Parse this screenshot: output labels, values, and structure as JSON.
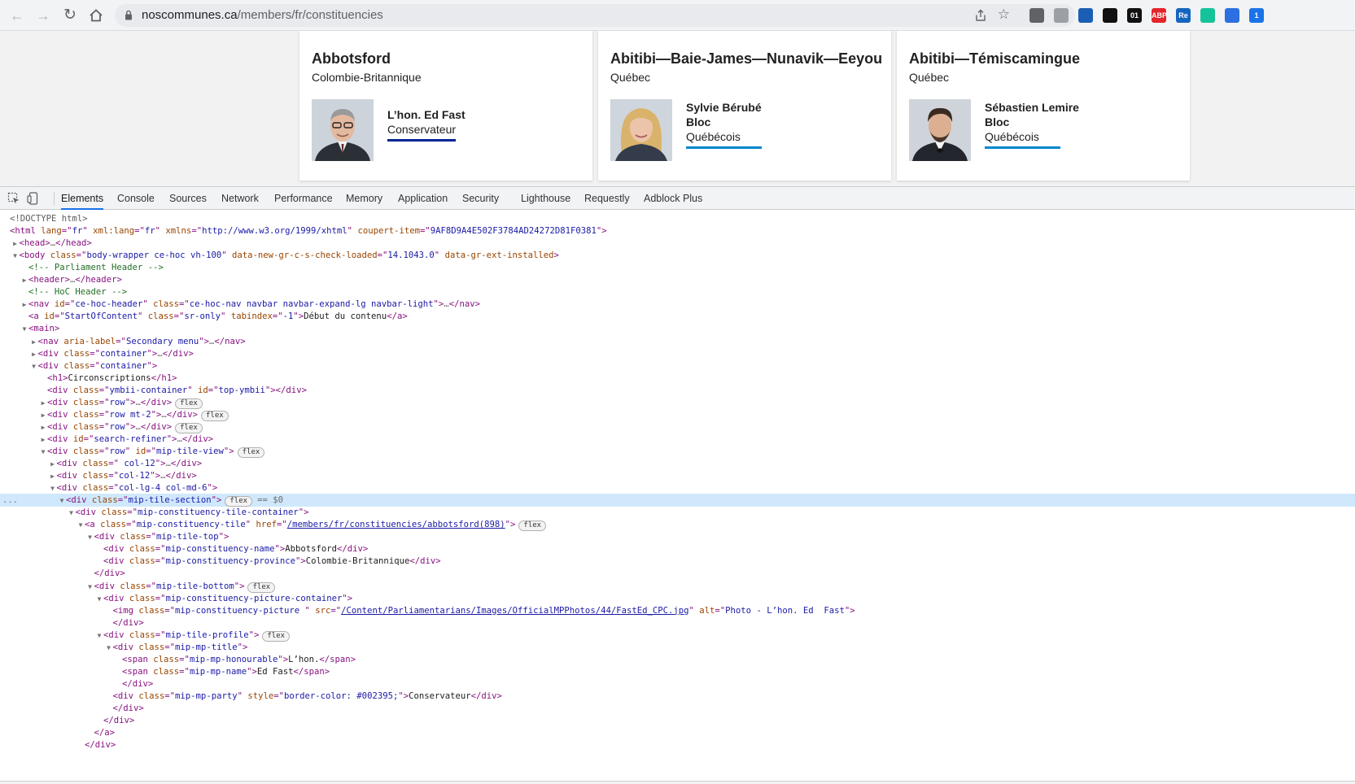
{
  "browser": {
    "url_host": "noscommunes.ca",
    "url_path": "/members/fr/constituencies",
    "extensions": [
      {
        "name": "search-ext",
        "label": "",
        "color": "#5f6368"
      },
      {
        "name": "reader-ext",
        "label": "",
        "color": "#9aa0a6"
      },
      {
        "name": "clock-ext",
        "label": "",
        "color": "#1a5fb4"
      },
      {
        "name": "notion-ext",
        "label": "",
        "color": "#111111"
      },
      {
        "name": "zero-one-ext",
        "label": "01",
        "color": "#111111"
      },
      {
        "name": "adblock-ext",
        "label": "ABP",
        "color": "#e3242b"
      },
      {
        "name": "re-ext",
        "label": "Re",
        "color": "#1565c0"
      },
      {
        "name": "grammarly-ext",
        "label": "",
        "color": "#15c39a"
      },
      {
        "name": "cap-ext",
        "label": "",
        "color": "#2c6fe0"
      },
      {
        "name": "person-ext",
        "label": "1",
        "color": "#1a73e8"
      }
    ]
  },
  "tiles": [
    {
      "name": "Abbotsford",
      "province": "Colombie-Britannique",
      "mp_lines": [
        "L’hon. Ed Fast"
      ],
      "party": "Conservateur",
      "party_color": "#002395"
    },
    {
      "name": "Abitibi—Baie-James—Nunavik—Eeyou",
      "province": "Québec",
      "mp_lines": [
        "Sylvie Bérubé",
        "Bloc"
      ],
      "party": "Québécois",
      "party_color": "#0088ce"
    },
    {
      "name": "Abitibi—Témiscamingue",
      "province": "Québec",
      "mp_lines": [
        "Sébastien Lemire",
        "Bloc"
      ],
      "party": "Québécois",
      "party_color": "#0088ce"
    }
  ],
  "devtools": {
    "tabs": [
      "Elements",
      "Console",
      "Sources",
      "Network",
      "Performance",
      "Memory",
      "Application",
      "Security",
      "Lighthouse",
      "Requestly",
      "Adblock Plus"
    ],
    "active_tab": "Elements"
  },
  "dom_lines": [
    [
      [
        0,
        "",
        ""
      ],
      [
        "dt",
        "<!DOCTYPE html>"
      ]
    ],
    [
      [
        0,
        "",
        ""
      ],
      [
        "tg",
        "<html "
      ],
      [
        "an",
        "lang"
      ],
      [
        "tg",
        "=\""
      ],
      [
        "av",
        "fr"
      ],
      [
        "tg",
        "\" "
      ],
      [
        "an",
        "xml:lang"
      ],
      [
        "tg",
        "=\""
      ],
      [
        "av",
        "fr"
      ],
      [
        "tg",
        "\" "
      ],
      [
        "an",
        "xmlns"
      ],
      [
        "tg",
        "=\""
      ],
      [
        "av",
        "http://www.w3.org/1999/xhtml"
      ],
      [
        "tg",
        "\" "
      ],
      [
        "an",
        "coupert-item"
      ],
      [
        "tg",
        "=\""
      ],
      [
        "av",
        "9AF8D9A4E502F3784AD24272D81F0381"
      ],
      [
        "tg",
        "\">"
      ]
    ],
    [
      [
        1,
        "▶",
        ""
      ],
      [
        "tg",
        "<head>"
      ],
      [
        "dim",
        "…"
      ],
      [
        "tg",
        "</head>"
      ]
    ],
    [
      [
        1,
        "▼",
        ""
      ],
      [
        "tg",
        "<body "
      ],
      [
        "an",
        "class"
      ],
      [
        "tg",
        "=\""
      ],
      [
        "av",
        "body-wrapper ce-hoc vh-100"
      ],
      [
        "tg",
        "\" "
      ],
      [
        "an",
        "data-new-gr-c-s-check-loaded"
      ],
      [
        "tg",
        "=\""
      ],
      [
        "av",
        "14.1043.0"
      ],
      [
        "tg",
        "\" "
      ],
      [
        "an",
        "data-gr-ext-installed"
      ],
      [
        "tg",
        ">"
      ]
    ],
    [
      [
        2,
        "",
        ""
      ],
      [
        "cm",
        "<!-- Parliament Header -->"
      ]
    ],
    [
      [
        2,
        "▶",
        ""
      ],
      [
        "tg",
        "<header>"
      ],
      [
        "dim",
        "…"
      ],
      [
        "tg",
        "</header>"
      ]
    ],
    [
      [
        2,
        "",
        ""
      ],
      [
        "cm",
        "<!-- HoC Header -->"
      ]
    ],
    [
      [
        2,
        "▶",
        ""
      ],
      [
        "tg",
        "<nav "
      ],
      [
        "an",
        "id"
      ],
      [
        "tg",
        "=\""
      ],
      [
        "av",
        "ce-hoc-header"
      ],
      [
        "tg",
        "\" "
      ],
      [
        "an",
        "class"
      ],
      [
        "tg",
        "=\""
      ],
      [
        "av",
        "ce-hoc-nav navbar navbar-expand-lg navbar-light"
      ],
      [
        "tg",
        "\">"
      ],
      [
        "dim",
        "…"
      ],
      [
        "tg",
        "</nav>"
      ]
    ],
    [
      [
        2,
        "",
        ""
      ],
      [
        "tg",
        "<a "
      ],
      [
        "an",
        "id"
      ],
      [
        "tg",
        "=\""
      ],
      [
        "av",
        "StartOfContent"
      ],
      [
        "tg",
        "\" "
      ],
      [
        "an",
        "class"
      ],
      [
        "tg",
        "=\""
      ],
      [
        "av",
        "sr-only"
      ],
      [
        "tg",
        "\" "
      ],
      [
        "an",
        "tabindex"
      ],
      [
        "tg",
        "=\""
      ],
      [
        "av",
        "-1"
      ],
      [
        "tg",
        "\">"
      ],
      [
        "tx",
        "Début du contenu"
      ],
      [
        "tg",
        "</a>"
      ]
    ],
    [
      [
        2,
        "▼",
        ""
      ],
      [
        "tg",
        "<main>"
      ]
    ],
    [
      [
        3,
        "▶",
        ""
      ],
      [
        "tg",
        "<nav "
      ],
      [
        "an",
        "aria-label"
      ],
      [
        "tg",
        "=\""
      ],
      [
        "av",
        "Secondary menu"
      ],
      [
        "tg",
        "\">"
      ],
      [
        "dim",
        "…"
      ],
      [
        "tg",
        "</nav>"
      ]
    ],
    [
      [
        3,
        "▶",
        ""
      ],
      [
        "tg",
        "<div "
      ],
      [
        "an",
        "class"
      ],
      [
        "tg",
        "=\""
      ],
      [
        "av",
        "container"
      ],
      [
        "tg",
        "\">"
      ],
      [
        "dim",
        "…"
      ],
      [
        "tg",
        "</div>"
      ]
    ],
    [
      [
        3,
        "▼",
        ""
      ],
      [
        "tg",
        "<div "
      ],
      [
        "an",
        "class"
      ],
      [
        "tg",
        "=\""
      ],
      [
        "av",
        "container"
      ],
      [
        "tg",
        "\">"
      ]
    ],
    [
      [
        4,
        "",
        ""
      ],
      [
        "tg",
        "<h1>"
      ],
      [
        "tx",
        "Circonscriptions"
      ],
      [
        "tg",
        "</h1>"
      ]
    ],
    [
      [
        4,
        "",
        ""
      ],
      [
        "tg",
        "<div "
      ],
      [
        "an",
        "class"
      ],
      [
        "tg",
        "=\""
      ],
      [
        "av",
        "ymbii-container"
      ],
      [
        "tg",
        "\" "
      ],
      [
        "an",
        "id"
      ],
      [
        "tg",
        "=\""
      ],
      [
        "av",
        "top-ymbii"
      ],
      [
        "tg",
        "\"></div>"
      ]
    ],
    [
      [
        4,
        "▶",
        "flex"
      ],
      [
        "tg",
        "<div "
      ],
      [
        "an",
        "class"
      ],
      [
        "tg",
        "=\""
      ],
      [
        "av",
        "row"
      ],
      [
        "tg",
        "\">"
      ],
      [
        "dim",
        "…"
      ],
      [
        "tg",
        "</div>"
      ]
    ],
    [
      [
        4,
        "▶",
        "flex"
      ],
      [
        "tg",
        "<div "
      ],
      [
        "an",
        "class"
      ],
      [
        "tg",
        "=\""
      ],
      [
        "av",
        "row mt-2"
      ],
      [
        "tg",
        "\">"
      ],
      [
        "dim",
        "…"
      ],
      [
        "tg",
        "</div>"
      ]
    ],
    [
      [
        4,
        "▶",
        "flex"
      ],
      [
        "tg",
        "<div "
      ],
      [
        "an",
        "class"
      ],
      [
        "tg",
        "=\""
      ],
      [
        "av",
        "row"
      ],
      [
        "tg",
        "\">"
      ],
      [
        "dim",
        "…"
      ],
      [
        "tg",
        "</div>"
      ]
    ],
    [
      [
        4,
        "▶",
        ""
      ],
      [
        "tg",
        "<div "
      ],
      [
        "an",
        "id"
      ],
      [
        "tg",
        "=\""
      ],
      [
        "av",
        "search-refiner"
      ],
      [
        "tg",
        "\">"
      ],
      [
        "dim",
        "…"
      ],
      [
        "tg",
        "</div>"
      ]
    ],
    [
      [
        4,
        "▼",
        "flex"
      ],
      [
        "tg",
        "<div "
      ],
      [
        "an",
        "class"
      ],
      [
        "tg",
        "=\""
      ],
      [
        "av",
        "row"
      ],
      [
        "tg",
        "\" "
      ],
      [
        "an",
        "id"
      ],
      [
        "tg",
        "=\""
      ],
      [
        "av",
        "mip-tile-view"
      ],
      [
        "tg",
        "\">"
      ]
    ],
    [
      [
        5,
        "▶",
        ""
      ],
      [
        "tg",
        "<div "
      ],
      [
        "an",
        "class"
      ],
      [
        "tg",
        "=\""
      ],
      [
        "av",
        " col-12"
      ],
      [
        "tg",
        "\">"
      ],
      [
        "dim",
        "…"
      ],
      [
        "tg",
        "</div>"
      ]
    ],
    [
      [
        5,
        "▶",
        ""
      ],
      [
        "tg",
        "<div "
      ],
      [
        "an",
        "class"
      ],
      [
        "tg",
        "=\""
      ],
      [
        "av",
        "col-12"
      ],
      [
        "tg",
        "\">"
      ],
      [
        "dim",
        "…"
      ],
      [
        "tg",
        "</div>"
      ]
    ],
    [
      [
        5,
        "▼",
        ""
      ],
      [
        "tg",
        "<div "
      ],
      [
        "an",
        "class"
      ],
      [
        "tg",
        "=\""
      ],
      [
        "av",
        "col-lg-4 col-md-6"
      ],
      [
        "tg",
        "\">"
      ]
    ],
    [
      [
        6,
        "▼",
        "flex",
        "sel"
      ],
      [
        "tg",
        "<div "
      ],
      [
        "an",
        "class"
      ],
      [
        "tg",
        "=\""
      ],
      [
        "av",
        "mip-tile-section"
      ],
      [
        "tg",
        "\">"
      ]
    ],
    [
      [
        7,
        "▼",
        ""
      ],
      [
        "tg",
        "<div "
      ],
      [
        "an",
        "class"
      ],
      [
        "tg",
        "=\""
      ],
      [
        "av",
        "mip-constituency-tile-container"
      ],
      [
        "tg",
        "\">"
      ]
    ],
    [
      [
        8,
        "▼",
        "flex"
      ],
      [
        "tg",
        "<a "
      ],
      [
        "an",
        "class"
      ],
      [
        "tg",
        "=\""
      ],
      [
        "av",
        "mip-constituency-tile"
      ],
      [
        "tg",
        "\" "
      ],
      [
        "an",
        "href"
      ],
      [
        "tg",
        "=\""
      ],
      [
        "lk",
        "/members/fr/constituencies/abbotsford(898)"
      ],
      [
        "tg",
        "\">"
      ]
    ],
    [
      [
        9,
        "▼",
        ""
      ],
      [
        "tg",
        "<div "
      ],
      [
        "an",
        "class"
      ],
      [
        "tg",
        "=\""
      ],
      [
        "av",
        "mip-tile-top"
      ],
      [
        "tg",
        "\">"
      ]
    ],
    [
      [
        10,
        "",
        ""
      ],
      [
        "tg",
        "<div "
      ],
      [
        "an",
        "class"
      ],
      [
        "tg",
        "=\""
      ],
      [
        "av",
        "mip-constituency-name"
      ],
      [
        "tg",
        "\">"
      ],
      [
        "tx",
        "Abbotsford"
      ],
      [
        "tg",
        "</div>"
      ]
    ],
    [
      [
        10,
        "",
        ""
      ],
      [
        "tg",
        "<div "
      ],
      [
        "an",
        "class"
      ],
      [
        "tg",
        "=\""
      ],
      [
        "av",
        "mip-constituency-province"
      ],
      [
        "tg",
        "\">"
      ],
      [
        "tx",
        "Colombie-Britannique"
      ],
      [
        "tg",
        "</div>"
      ]
    ],
    [
      [
        9,
        "",
        ""
      ],
      [
        "tg",
        "</div>"
      ]
    ],
    [
      [
        9,
        "▼",
        "flex"
      ],
      [
        "tg",
        "<div "
      ],
      [
        "an",
        "class"
      ],
      [
        "tg",
        "=\""
      ],
      [
        "av",
        "mip-tile-bottom"
      ],
      [
        "tg",
        "\">"
      ]
    ],
    [
      [
        10,
        "▼",
        ""
      ],
      [
        "tg",
        "<div "
      ],
      [
        "an",
        "class"
      ],
      [
        "tg",
        "=\""
      ],
      [
        "av",
        "mip-constituency-picture-container"
      ],
      [
        "tg",
        "\">"
      ]
    ],
    [
      [
        11,
        "",
        ""
      ],
      [
        "tg",
        "<img "
      ],
      [
        "an",
        "class"
      ],
      [
        "tg",
        "=\""
      ],
      [
        "av",
        "mip-constituency-picture "
      ],
      [
        "tg",
        "\" "
      ],
      [
        "an",
        "src"
      ],
      [
        "tg",
        "=\""
      ],
      [
        "lk",
        "/Content/Parliamentarians/Images/OfficialMPPhotos/44/FastEd_CPC.jpg"
      ],
      [
        "tg",
        "\" "
      ],
      [
        "an",
        "alt"
      ],
      [
        "tg",
        "=\""
      ],
      [
        "av",
        "Photo - L’hon. Ed  Fast"
      ],
      [
        "tg",
        "\">"
      ]
    ],
    [
      [
        11,
        "",
        ""
      ],
      [
        "tg",
        "</div>"
      ]
    ],
    [
      [
        10,
        "▼",
        "flex"
      ],
      [
        "tg",
        "<div "
      ],
      [
        "an",
        "class"
      ],
      [
        "tg",
        "=\""
      ],
      [
        "av",
        "mip-tile-profile"
      ],
      [
        "tg",
        "\">"
      ]
    ],
    [
      [
        11,
        "▼",
        ""
      ],
      [
        "tg",
        "<div "
      ],
      [
        "an",
        "class"
      ],
      [
        "tg",
        "=\""
      ],
      [
        "av",
        "mip-mp-title"
      ],
      [
        "tg",
        "\">"
      ]
    ],
    [
      [
        12,
        "",
        ""
      ],
      [
        "tg",
        "<span "
      ],
      [
        "an",
        "class"
      ],
      [
        "tg",
        "=\""
      ],
      [
        "av",
        "mip-mp-honourable"
      ],
      [
        "tg",
        "\">"
      ],
      [
        "tx",
        "L’hon."
      ],
      [
        "tg",
        "</span>"
      ]
    ],
    [
      [
        12,
        "",
        ""
      ],
      [
        "tg",
        "<span "
      ],
      [
        "an",
        "class"
      ],
      [
        "tg",
        "=\""
      ],
      [
        "av",
        "mip-mp-name"
      ],
      [
        "tg",
        "\">"
      ],
      [
        "tx",
        "Ed Fast"
      ],
      [
        "tg",
        "</span>"
      ]
    ],
    [
      [
        12,
        "",
        ""
      ],
      [
        "tg",
        "</div>"
      ]
    ],
    [
      [
        11,
        "",
        ""
      ],
      [
        "tg",
        "<div "
      ],
      [
        "an",
        "class"
      ],
      [
        "tg",
        "=\""
      ],
      [
        "av",
        "mip-mp-party"
      ],
      [
        "tg",
        "\" "
      ],
      [
        "an",
        "style"
      ],
      [
        "tg",
        "=\""
      ],
      [
        "av",
        "border-color: #002395;"
      ],
      [
        "tg",
        "\">"
      ],
      [
        "tx",
        "Conservateur"
      ],
      [
        "tg",
        "</div>"
      ]
    ],
    [
      [
        11,
        "",
        ""
      ],
      [
        "tg",
        "</div>"
      ]
    ],
    [
      [
        10,
        "",
        ""
      ],
      [
        "tg",
        "</div>"
      ]
    ],
    [
      [
        9,
        "",
        ""
      ],
      [
        "tg",
        "</a>"
      ]
    ],
    [
      [
        8,
        "",
        ""
      ],
      [
        "tg",
        "</div>"
      ]
    ]
  ],
  "selected_marker": "== $0",
  "gutter_marker": "..."
}
